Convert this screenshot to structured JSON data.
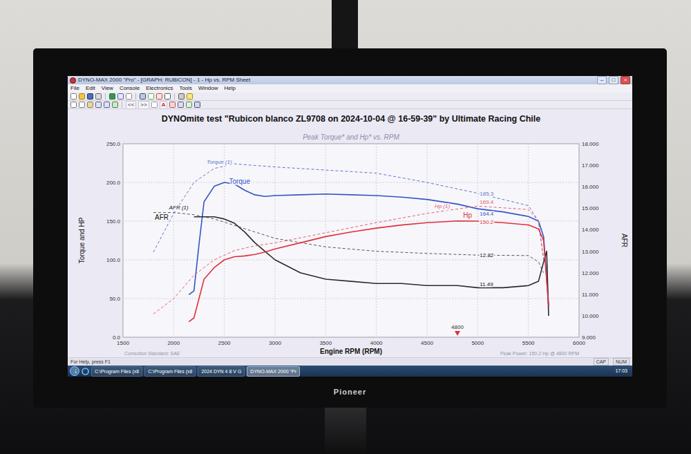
{
  "window": {
    "title": "DYNO-MAX 2000 \"Pro\" - [GRAPH: RUBICON] - 1 - Hp vs. RPM Sheet",
    "controls": [
      "–",
      "□",
      "×"
    ]
  },
  "menu": [
    "File",
    "Edit",
    "View",
    "Console",
    "Electronics",
    "Tools",
    "Window",
    "Help"
  ],
  "toolbar": {
    "glyphs": [
      "<<",
      ">>",
      "A"
    ]
  },
  "chart": {
    "title": "DYNOmite test \"Rubicon blanco ZL9708 on 2024-10-04 @ 16-59-39\" by Ultimate Racing Chile",
    "subtitle": "Peak Torque* and Hp* vs. RPM",
    "x_axis": {
      "label": "Engine RPM (RPM)",
      "ticks": [
        "1500",
        "2000",
        "2500",
        "3000",
        "3500",
        "4000",
        "4500",
        "5000",
        "5500",
        "6000"
      ]
    },
    "y_axis_left": {
      "label": "Torque and HP",
      "ticks": [
        "0.0",
        "50.0",
        "100.0",
        "150.0",
        "200.0",
        "250.0"
      ]
    },
    "y_axis_right": {
      "label": "AFR",
      "ticks": [
        "9.000",
        "10.000",
        "11.000",
        "12.000",
        "13.000",
        "14.000",
        "15.000",
        "16.000",
        "17.000",
        "18.000"
      ]
    },
    "series": [
      {
        "name": "Torque (1)",
        "axis": "left",
        "kind": "previous",
        "color": "#5a76c8",
        "value_label": "185.3",
        "rpm": [
          1800,
          2000,
          2200,
          2400,
          2600,
          2800,
          3000,
          3500,
          4000,
          4500,
          5000,
          5500,
          5600,
          5650
        ],
        "values": [
          110,
          160,
          200,
          218,
          224,
          222,
          220,
          216,
          212,
          200,
          186,
          170,
          150,
          100
        ]
      },
      {
        "name": "Torque",
        "axis": "left",
        "kind": "current",
        "color": "#3454c4",
        "value_label": "164.4",
        "rpm": [
          2150,
          2200,
          2250,
          2300,
          2400,
          2500,
          2600,
          2700,
          2800,
          2900,
          3000,
          3250,
          3500,
          3750,
          4000,
          4250,
          4500,
          4800,
          5000,
          5250,
          5500,
          5600,
          5650,
          5700
        ],
        "values": [
          55,
          60,
          120,
          175,
          195,
          200,
          198,
          190,
          184,
          182,
          183,
          184,
          185,
          184,
          183,
          181,
          178,
          172,
          166,
          162,
          156,
          150,
          130,
          40
        ]
      },
      {
        "name": "AFR (1)",
        "axis": "right",
        "kind": "previous",
        "color": "#555555",
        "value_label": "12.82",
        "rpm": [
          1800,
          2000,
          2200,
          2400,
          2600,
          2800,
          3000,
          3500,
          4000,
          4500,
          5000,
          5500,
          5600,
          5650
        ],
        "values": [
          14.8,
          14.8,
          14.7,
          14.5,
          14.2,
          13.9,
          13.6,
          13.2,
          13.0,
          12.9,
          12.82,
          12.8,
          12.5,
          12.0
        ]
      },
      {
        "name": "AFR",
        "axis": "right",
        "kind": "current",
        "color": "#2b2b2b",
        "value_label": "11.49",
        "rpm": [
          2200,
          2250,
          2300,
          2400,
          2500,
          2600,
          2700,
          2800,
          2900,
          3000,
          3250,
          3500,
          3750,
          4000,
          4250,
          4500,
          4800,
          5000,
          5250,
          5500,
          5600,
          5650,
          5680,
          5700
        ],
        "values": [
          14.6,
          14.6,
          14.6,
          14.6,
          14.5,
          14.3,
          13.9,
          13.4,
          13.0,
          12.6,
          12.0,
          11.7,
          11.6,
          11.5,
          11.5,
          11.4,
          11.4,
          11.3,
          11.3,
          11.4,
          11.6,
          12.5,
          13.0,
          10.0
        ]
      },
      {
        "name": "Hp (1)",
        "axis": "left",
        "kind": "previous",
        "color": "#e06070",
        "value_label": "169.4",
        "rpm": [
          1800,
          2000,
          2200,
          2400,
          2600,
          2800,
          3000,
          3500,
          4000,
          4500,
          5000,
          5500,
          5600,
          5650
        ],
        "values": [
          30,
          50,
          80,
          100,
          112,
          118,
          122,
          135,
          148,
          160,
          169.4,
          165,
          150,
          100
        ]
      },
      {
        "name": "Hp",
        "axis": "left",
        "kind": "current",
        "color": "#e0303a",
        "value_label": "150.2",
        "rpm": [
          2150,
          2200,
          2250,
          2300,
          2400,
          2500,
          2600,
          2700,
          2800,
          2900,
          3000,
          3250,
          3500,
          3750,
          4000,
          4250,
          4500,
          4800,
          5000,
          5250,
          5500,
          5600,
          5650,
          5700
        ],
        "values": [
          20,
          25,
          50,
          75,
          90,
          100,
          104,
          105,
          107,
          110,
          114,
          122,
          130,
          136,
          141,
          145,
          148,
          150.2,
          150,
          148,
          145,
          140,
          125,
          40
        ]
      }
    ],
    "marker": {
      "label": "4800",
      "color": "#e0303a"
    },
    "footer_left": "Correction Standard: SAE",
    "footer_right": "Peak Power: 150.2 Hp @ 4800 RPM"
  },
  "status_bar": {
    "help": "For Help, press F1",
    "indicators": [
      "CAP",
      "NUM"
    ]
  },
  "taskbar": {
    "items": [
      {
        "label": "C:\\Program Files (x8",
        "selected": false
      },
      {
        "label": "C:\\Program Files (x8",
        "selected": false
      },
      {
        "label": "2024 DYN 4 8 V G",
        "selected": false
      },
      {
        "label": "DYNO-MAX 2000 \"Pr",
        "selected": true
      }
    ],
    "clock": "17:03"
  },
  "monitor": {
    "brand": "Pioneer"
  }
}
